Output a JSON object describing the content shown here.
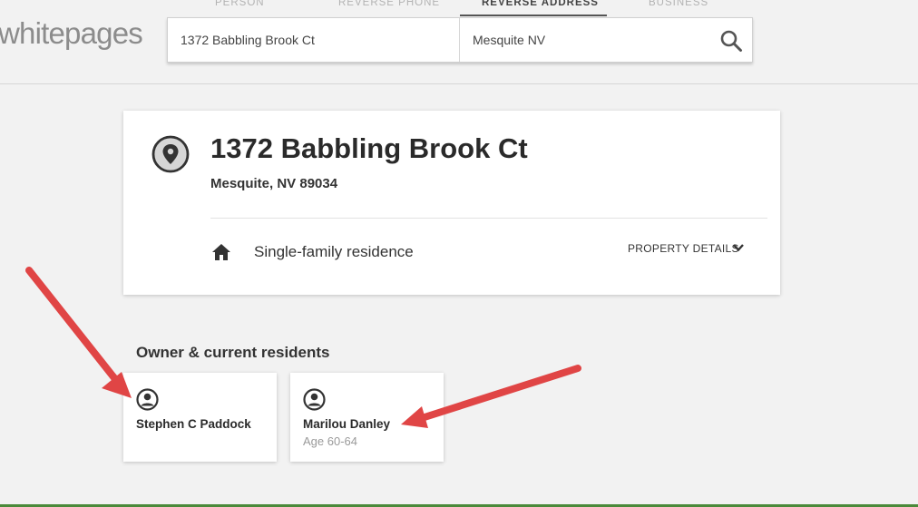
{
  "header": {
    "logo": "whitepages",
    "tabs": [
      {
        "label": "PERSON",
        "active": false
      },
      {
        "label": "REVERSE PHONE",
        "active": false
      },
      {
        "label": "REVERSE ADDRESS",
        "active": true
      },
      {
        "label": "BUSINESS",
        "active": false
      }
    ],
    "search": {
      "address_value": "1372 Babbling Brook Ct",
      "location_value": "Mesquite NV",
      "icon": "search-icon"
    }
  },
  "property": {
    "icon": "location-pin-icon",
    "title": "1372 Babbling Brook Ct",
    "subtitle": "Mesquite, NV 89034",
    "type_icon": "home-icon",
    "type": "Single-family residence",
    "details_label": "PROPERTY DETAILS",
    "details_icon": "chevron-down-icon"
  },
  "residents": {
    "title": "Owner & current residents",
    "people": [
      {
        "name": "Stephen C Paddock",
        "age": ""
      },
      {
        "name": "Marilou Danley",
        "age": "Age 60-64"
      }
    ]
  },
  "colors": {
    "arrow": "#e04545",
    "accent_line": "#4a8a3a"
  }
}
